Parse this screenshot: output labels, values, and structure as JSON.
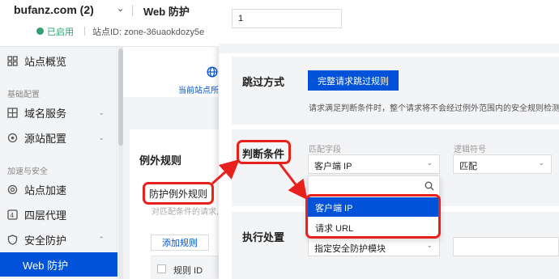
{
  "site": {
    "name": "bufanz.com (2)",
    "page": "Web 防护",
    "status": "已启用",
    "site_id": "站点ID: zone-36uaokdozy5e"
  },
  "sidebar": {
    "items": [
      {
        "label": "站点概览",
        "icon": "dashboard-icon"
      },
      {
        "label": "域名服务",
        "icon": "domain-service-icon"
      },
      {
        "label": "源站配置",
        "icon": "origin-config-icon"
      },
      {
        "label": "站点加速",
        "icon": "acceleration-icon"
      },
      {
        "label": "四层代理",
        "icon": "l4-proxy-icon"
      },
      {
        "label": "安全防护",
        "icon": "shield-icon"
      },
      {
        "label": "Web 防护"
      }
    ],
    "groups": [
      "基础配置",
      "加速与安全"
    ]
  },
  "middle": {
    "tab_label": "当前站点所",
    "card_title": "例外规则",
    "rule_title": "防护例外规则",
    "rule_desc": "对匹配条件的请求,",
    "add_rule": "添加规则",
    "col_rule_id": "规则 ID"
  },
  "panel": {
    "top_input_value": "1",
    "skip_mode": {
      "label": "跳过方式",
      "button": "完整请求跳过规则",
      "hint": "请求满足判断条件时，整个请求将不会经过例外范围内的安全规则检测。"
    },
    "condition": {
      "label": "判断条件",
      "field_label": "匹配字段",
      "field_value": "客户端 IP",
      "op_label": "逻辑符号",
      "op_value": "匹配"
    },
    "dropdown": {
      "options": [
        "客户端 IP",
        "请求 URL"
      ],
      "selected": "客户端 IP"
    },
    "action": {
      "label": "执行处置",
      "select_value": "指定安全防护模块"
    }
  },
  "colors": {
    "primary": "#0052d9",
    "success": "#2ba471",
    "annotation": "#e8211c"
  }
}
